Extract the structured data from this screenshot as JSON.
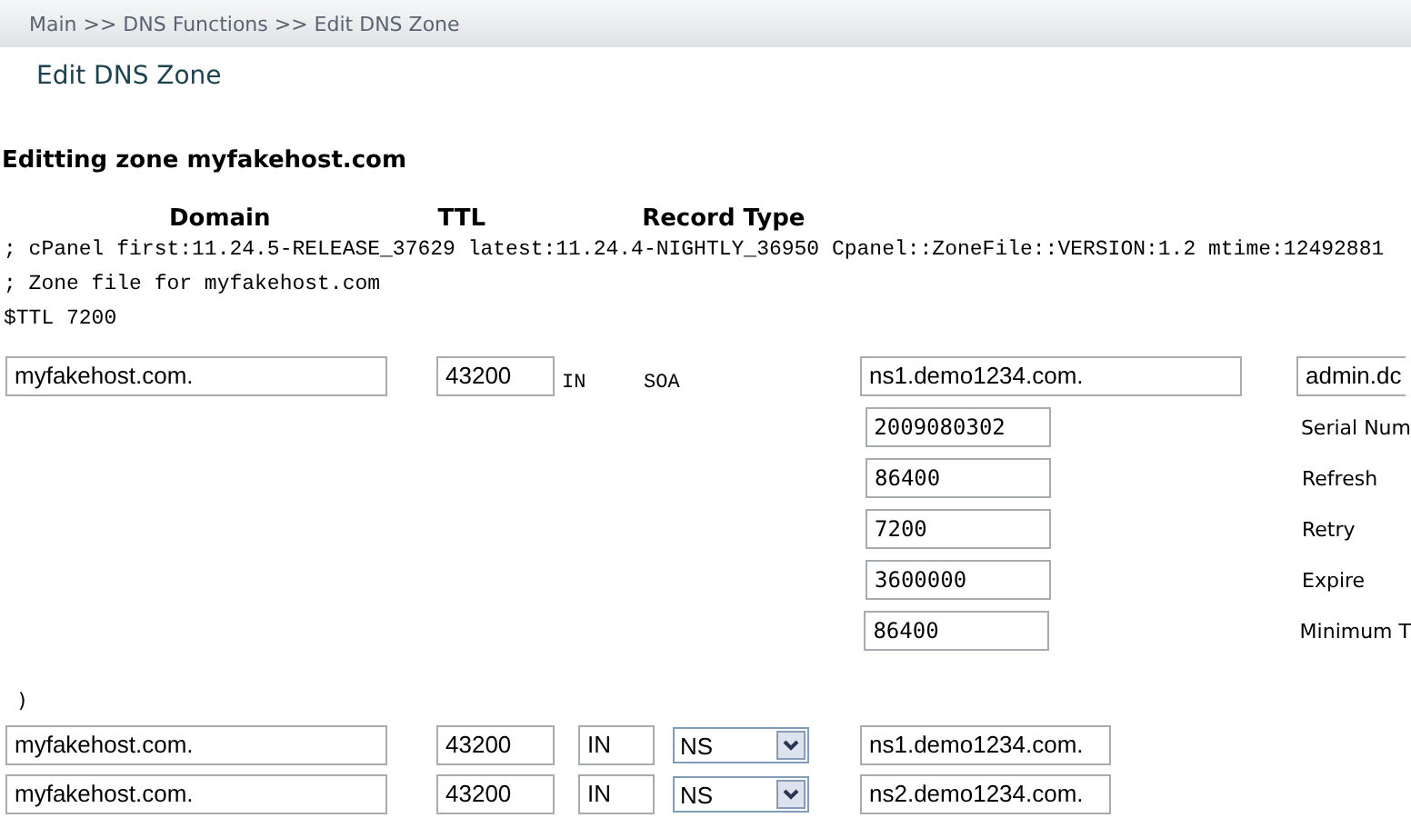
{
  "breadcrumb": "Main >> DNS Functions >> Edit DNS Zone",
  "page_title": "Edit DNS Zone",
  "zone_heading": "Editting zone myfakehost.com",
  "columns": [
    "Domain",
    "TTL",
    "Record Type"
  ],
  "comment_lines": [
    "; cPanel first:11.24.5-RELEASE_37629 latest:11.24.4-NIGHTLY_36950 Cpanel::ZoneFile::VERSION:1.2 mtime:12492881",
    "; Zone file for myfakehost.com",
    "$TTL 7200"
  ],
  "soa": {
    "domain": "myfakehost.com.",
    "ttl": "43200",
    "class": "IN",
    "type": "SOA",
    "primary_ns": "ns1.demo1234.com.",
    "admin_email": "admin.dc",
    "fields": [
      {
        "value": "2009080302",
        "label": "Serial Num"
      },
      {
        "value": "86400",
        "label": "Refresh"
      },
      {
        "value": "7200",
        "label": "Retry"
      },
      {
        "value": "3600000",
        "label": "Expire"
      },
      {
        "value": "86400",
        "label": "Minimum T"
      }
    ],
    "closing": ")"
  },
  "records": [
    {
      "domain": "myfakehost.com.",
      "ttl": "43200",
      "class": "IN",
      "type": "NS",
      "value": "ns1.demo1234.com."
    },
    {
      "domain": "myfakehost.com.",
      "ttl": "43200",
      "class": "IN",
      "type": "NS",
      "value": "ns2.demo1234.com."
    }
  ]
}
